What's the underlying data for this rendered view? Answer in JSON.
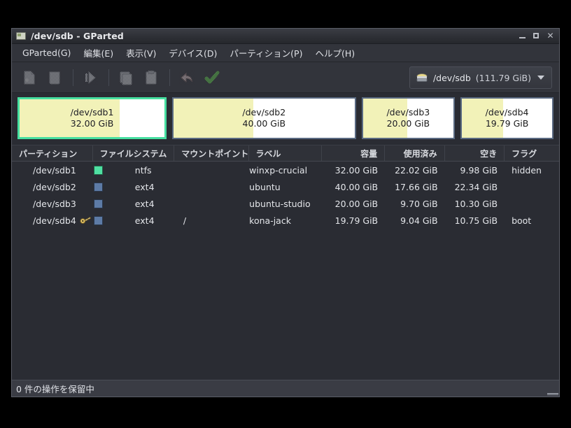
{
  "window": {
    "title": "/dev/sdb - GParted",
    "icon": "gparted-window-icon",
    "minimize_label": "",
    "maximize_label": "",
    "close_label": "✕"
  },
  "menubar": {
    "items": [
      {
        "label": "GParted(G)",
        "name": "menu-gparted"
      },
      {
        "label": "編集(E)",
        "name": "menu-edit"
      },
      {
        "label": "表示(V)",
        "name": "menu-view"
      },
      {
        "label": "デバイス(D)",
        "name": "menu-device"
      },
      {
        "label": "パーティション(P)",
        "name": "menu-partition"
      },
      {
        "label": "ヘルプ(H)",
        "name": "menu-help"
      }
    ]
  },
  "toolbar": {
    "buttons": [
      {
        "name": "new-partition-button",
        "icon": "new-partition-icon",
        "enabled": false
      },
      {
        "name": "delete-partition-button",
        "icon": "delete-partition-icon",
        "enabled": false
      },
      {
        "name": "resize-move-button",
        "icon": "resize-move-icon",
        "enabled": false
      },
      {
        "name": "copy-button",
        "icon": "copy-icon",
        "enabled": false
      },
      {
        "name": "paste-button",
        "icon": "paste-icon",
        "enabled": false
      },
      {
        "name": "undo-button",
        "icon": "undo-arrow-icon",
        "enabled": false
      },
      {
        "name": "apply-button",
        "icon": "apply-checkmark-icon",
        "enabled": false
      }
    ]
  },
  "device_selector": {
    "icon": "harddisk-icon",
    "device": "/dev/sdb",
    "size": "(111.79 GiB)",
    "caret": "chevron-down-icon"
  },
  "graphic": {
    "partitions": [
      {
        "name": "/dev/sdb1",
        "size_label": "32.00 GiB",
        "width_pct": 28.6,
        "used_pct": 69,
        "selected": true,
        "border_color": "#46dfa0",
        "used_color": "#f2f2b8",
        "free_color": "#ffffff"
      },
      {
        "name": "/dev/sdb2",
        "size_label": "40.00 GiB",
        "width_pct": 35.7,
        "used_pct": 44,
        "selected": false,
        "border_color": "#5a6a82",
        "used_color": "#f2f2b8",
        "free_color": "#ffffff"
      },
      {
        "name": "/dev/sdb3",
        "size_label": "20.00 GiB",
        "width_pct": 17.9,
        "used_pct": 49,
        "selected": false,
        "border_color": "#5a6a82",
        "used_color": "#f2f2b8",
        "free_color": "#ffffff"
      },
      {
        "name": "/dev/sdb4",
        "size_label": "19.79 GiB",
        "width_pct": 17.8,
        "used_pct": 46,
        "selected": false,
        "border_color": "#5a6a82",
        "used_color": "#f2f2b8",
        "free_color": "#ffffff"
      }
    ]
  },
  "table": {
    "columns": [
      {
        "label": "パーティション",
        "name": "column-partition",
        "align": "left",
        "width": 122
      },
      {
        "label": "ファイルシステム",
        "name": "column-filesystem",
        "align": "left",
        "width": 123
      },
      {
        "label": "マウントポイント",
        "name": "column-mountpoint",
        "align": "left",
        "width": 112
      },
      {
        "label": "ラベル",
        "name": "column-label",
        "align": "left",
        "width": 110
      },
      {
        "label": "容量",
        "name": "column-size",
        "align": "right",
        "width": 95
      },
      {
        "label": "使用済み",
        "name": "column-used",
        "align": "right",
        "width": 90
      },
      {
        "label": "空き",
        "name": "column-unused",
        "align": "right",
        "width": 90
      },
      {
        "label": "フラグ",
        "name": "column-flags",
        "align": "left",
        "width": 82
      }
    ],
    "rows": [
      {
        "partition": "/dev/sdb1",
        "mounted_key": false,
        "fs_color": "#4fe0a2",
        "filesystem": "ntfs",
        "mountpoint": "",
        "label": "winxp-crucial",
        "size": "32.00 GiB",
        "used": "22.02 GiB",
        "unused": "9.98 GiB",
        "flags": "hidden"
      },
      {
        "partition": "/dev/sdb2",
        "mounted_key": false,
        "fs_color": "#5d7ba6",
        "filesystem": "ext4",
        "mountpoint": "",
        "label": "ubuntu",
        "size": "40.00 GiB",
        "used": "17.66 GiB",
        "unused": "22.34 GiB",
        "flags": ""
      },
      {
        "partition": "/dev/sdb3",
        "mounted_key": false,
        "fs_color": "#5d7ba6",
        "filesystem": "ext4",
        "mountpoint": "",
        "label": "ubuntu-studio",
        "size": "20.00 GiB",
        "used": "9.70 GiB",
        "unused": "10.30 GiB",
        "flags": ""
      },
      {
        "partition": "/dev/sdb4",
        "mounted_key": true,
        "fs_color": "#5d7ba6",
        "filesystem": "ext4",
        "mountpoint": "/",
        "label": "kona-jack",
        "size": "19.79 GiB",
        "used": "9.04 GiB",
        "unused": "10.75 GiB",
        "flags": "boot"
      }
    ]
  },
  "statusbar": {
    "text": "0 件の操作を保留中"
  }
}
